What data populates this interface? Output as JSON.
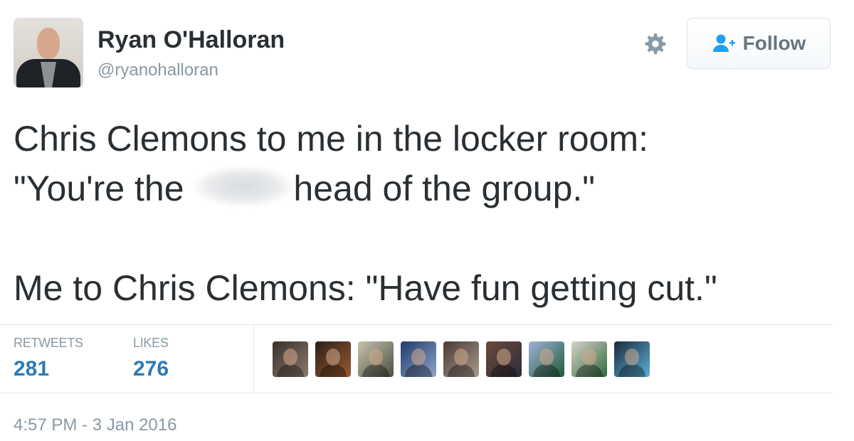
{
  "author": {
    "display_name": "Ryan O'Halloran",
    "handle": "@ryanohalloran",
    "avatar_icon": "profile-photo"
  },
  "actions": {
    "settings_icon": "gear-icon",
    "follow_label": "Follow",
    "follow_icon": "add-user-icon"
  },
  "tweet": {
    "line1": "Chris Clemons to me in the locker room:",
    "line2_before": "\"You're the ",
    "line2_after": "head of the group.\"",
    "line3": "Me to Chris Clemons: \"Have fun getting cut.\""
  },
  "stats": {
    "retweets_label": "RETWEETS",
    "retweets_count": "281",
    "likes_label": "LIKES",
    "likes_count": "276"
  },
  "likers_count_shown": 9,
  "timestamp": "4:57 PM - 3 Jan 2016",
  "colors": {
    "link_blue": "#2b7bb9",
    "muted_gray": "#8899a6",
    "text": "#292f33",
    "border": "#e1e8ed"
  }
}
